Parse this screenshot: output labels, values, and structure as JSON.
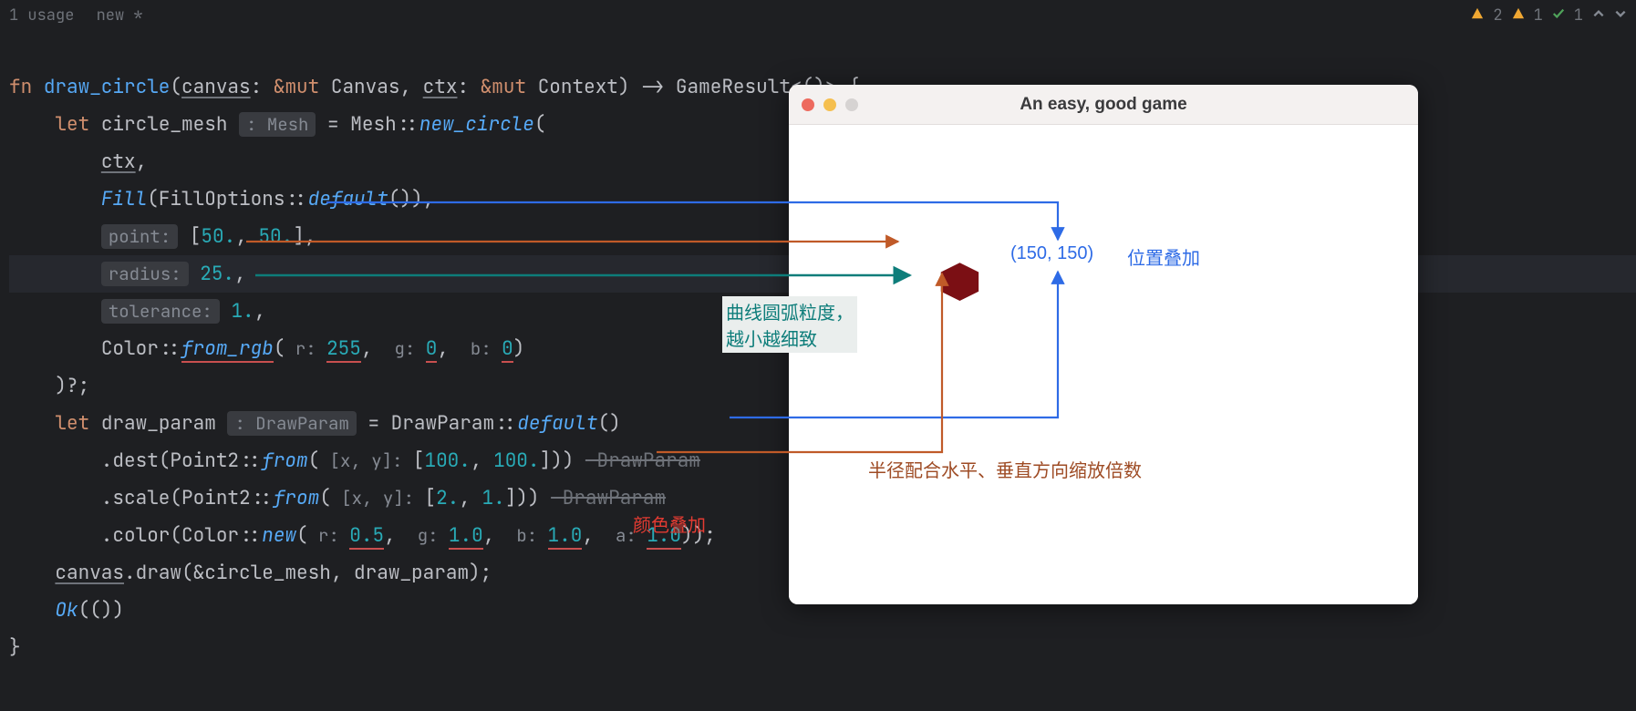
{
  "header": {
    "usages": "1 usage",
    "blame": "new *"
  },
  "status": {
    "warn1_count": "2",
    "warn2_count": "1",
    "check_count": "1"
  },
  "code": {
    "fn_kw": "fn",
    "fn_name": "draw_circle",
    "param_canvas": "canvas",
    "amp_mut1": "&mut",
    "type_canvas": "Canvas",
    "param_ctx": "ctx",
    "amp_mut2": "&mut",
    "type_context": "Context",
    "arrow": "->",
    "ret_type": "GameResult<()>",
    "let1": "let",
    "circle_mesh": "circle_mesh",
    "hint_mesh": ": Mesh",
    "eq1": " = ",
    "mesh_type": "Mesh",
    "new_circle": "new_circle",
    "ctx_arg": "ctx",
    "fill": "Fill",
    "fillopts": "FillOptions",
    "default1": "default",
    "hint_point": "point:",
    "point_arr": " [",
    "p50a": "50.",
    "p50b": "50.",
    "hint_radius": "radius:",
    "r25": "25.",
    "hint_tol": "tolerance:",
    "t1": "1.",
    "color_type": "Color",
    "from_rgb": "from_rgb",
    "hint_r": "r:",
    "v255": "255",
    "hint_g": "g:",
    "v0a": "0",
    "hint_b": "b:",
    "v0b": "0",
    "qmark": ")?;",
    "let2": "let",
    "draw_param": "draw_param",
    "hint_dp": ": DrawParam",
    "eq2": " = ",
    "dp_type": "DrawParam",
    "default2": "default",
    "dest": "dest",
    "point2a": "Point2",
    "from1": "from",
    "hint_xy1": "[x, y]:",
    "d100a": "100.",
    "d100b": "100.",
    "strike_dp1": " DrawParam",
    "scale": "scale",
    "point2b": "Point2",
    "from2": "from",
    "hint_xy2": "[x, y]:",
    "s2": "2.",
    "s1": "1.",
    "strike_dp2": " DrawParam",
    "color_m": "color",
    "color_type2": "Color",
    "new_m": "new",
    "hint_r2": "r:",
    "v05": "0.5",
    "hint_g2": "g:",
    "v10a": "1.0",
    "hint_b2": "b:",
    "v10b": "1.0",
    "hint_a2": "a:",
    "v10c": "1.0",
    "canvas2": "canvas",
    "draw_m": "draw",
    "amp_circle": "&circle_mesh",
    "dp_arg": "draw_param",
    "ok": "Ok",
    "unit": "(())"
  },
  "window": {
    "title": "An easy, good game",
    "coord_label": "(150,  150)"
  },
  "annotations": {
    "pos_overlay": "位置叠加",
    "arc_granularity": "曲线圆弧粒度，\n越小越细致",
    "radius_scale": "半径配合水平、垂直方向缩放倍数",
    "color_overlay": "颜色叠加"
  }
}
